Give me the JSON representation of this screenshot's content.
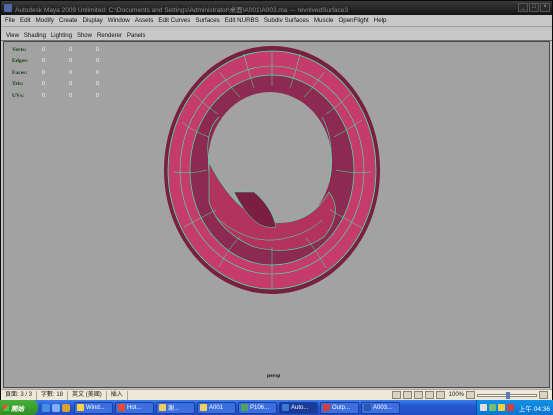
{
  "window": {
    "title": "Autodesk Maya 2009 Unlimited: C:\\Documents and Settings\\Administrator\\桌面\\A001\\A003.ma  ---  revolvedSurface3"
  },
  "menubar": [
    "File",
    "Edit",
    "Modify",
    "Create",
    "Display",
    "Window",
    "Assets",
    "Edit Curves",
    "Surfaces",
    "Edit NURBS",
    "Subdiv Surfaces",
    "Muscle",
    "OpenFlight",
    "Help"
  ],
  "panel_menu": [
    "View",
    "Shading",
    "Lighting",
    "Show",
    "Renderer",
    "Panels"
  ],
  "hud": {
    "rows": [
      {
        "label": "Verts:",
        "values": [
          "0",
          "0",
          "0"
        ]
      },
      {
        "label": "Edges:",
        "values": [
          "0",
          "0",
          "0"
        ]
      },
      {
        "label": "Faces:",
        "values": [
          "0",
          "0",
          "0"
        ]
      },
      {
        "label": "Tris:",
        "values": [
          "0",
          "0",
          "0"
        ]
      },
      {
        "label": "UVs:",
        "values": [
          "0",
          "0",
          "0"
        ]
      }
    ],
    "camera": "persp"
  },
  "statusbar": {
    "page": "頁面: 3 / 3",
    "words": "字數: 18",
    "language": "英文 (美國)",
    "mode": "插入",
    "zoom": "100%",
    "zoom_level": 0.5
  },
  "taskbar": {
    "start": "開始",
    "tasks": [
      "Wind...",
      "Hot...",
      "謝...",
      "A001",
      "P106...",
      "Auto...",
      "Outp...",
      "A003..."
    ],
    "clock": "上午 04:36"
  },
  "colors": {
    "surface": "#c53c6c",
    "wireframe": "#3cf0a8",
    "viewport_bg": "#a2a2a2"
  }
}
